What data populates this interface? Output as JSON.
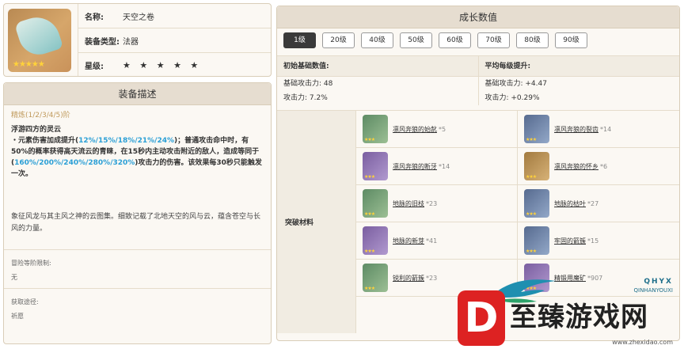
{
  "item": {
    "name_label": "名称:",
    "name": "天空之卷",
    "type_label": "装备类型:",
    "type": "法器",
    "rarity_label": "星级:",
    "rarity_stars": "★ ★ ★ ★ ★",
    "icon_stars": "★★★★★"
  },
  "description": {
    "title": "装备描述",
    "refine": "精炼(1/2/3/4/5)阶",
    "passive_name": "浮游四方的灵云",
    "passive_p1": "・元素伤害加成提升(",
    "passive_v1": "12%/15%/18%/21%/24%",
    "passive_p2": ")；普通攻击命中时，有50%的概率获得高天流云的青睐，在15秒内主动攻击附近的敌人，造成等同于(",
    "passive_v2": "160%/200%/240%/280%/320%",
    "passive_p3": ")攻击力的伤害。该效果每30秒只能触发一次。",
    "lore": "象征风龙与其主风之神的云图集。细致记载了北地天空的风与云，蕴含苍空与长风的力量。",
    "max_refine_label": "冒险等阶限制:",
    "max_refine_value": "无",
    "source_label": "获取途径:",
    "source_value": "祈愿"
  },
  "growth": {
    "title": "成长数值",
    "levels": [
      "1级",
      "20级",
      "40级",
      "50级",
      "60级",
      "70级",
      "80级",
      "90级"
    ],
    "active_level": "1级",
    "base_head": "初始基础数值:",
    "base_atk": "基础攻击力: 48",
    "base_sub": "攻击力: 7.2%",
    "avg_head": "平均每级提升:",
    "avg_atk": "基础攻击力: +4.47",
    "avg_sub": "攻击力: +0.29%"
  },
  "materials": {
    "label": "突破材料",
    "items": [
      {
        "name": "凛风奔狼的始龀",
        "count": "*5",
        "icon": "tooth-icon",
        "tone": "g-green"
      },
      {
        "name": "凛风奔狼的裂齿",
        "count": "*14",
        "icon": "fang-icon",
        "tone": "g-blue"
      },
      {
        "name": "凛风奔狼的断牙",
        "count": "*14",
        "icon": "broken-fang-icon",
        "tone": "g-purple"
      },
      {
        "name": "凛风奔狼的怀乡",
        "count": "*6",
        "icon": "horn-icon",
        "tone": "g-gold"
      },
      {
        "name": "地脉的旧枝",
        "count": "*23",
        "icon": "branch-icon",
        "tone": "g-green"
      },
      {
        "name": "地脉的枯叶",
        "count": "*27",
        "icon": "leaf-icon",
        "tone": "g-blue"
      },
      {
        "name": "地脉的新芽",
        "count": "*41",
        "icon": "sprout-icon",
        "tone": "g-purple"
      },
      {
        "name": "牢固的箭簇",
        "count": "*15",
        "icon": "arrowhead-icon",
        "tone": "g-blue"
      },
      {
        "name": "锐利的箭簇",
        "count": "*23",
        "icon": "sharp-arrowhead-icon",
        "tone": "g-green"
      },
      {
        "name": "精锻用魔矿",
        "count": "*907",
        "icon": "ore-icon",
        "tone": "g-purple"
      }
    ]
  },
  "watermark": {
    "brand": "QHYX",
    "brand_sub": "QINHANYOUXI",
    "big_text": "至臻游戏网",
    "url": "www.zhexidao.com"
  }
}
